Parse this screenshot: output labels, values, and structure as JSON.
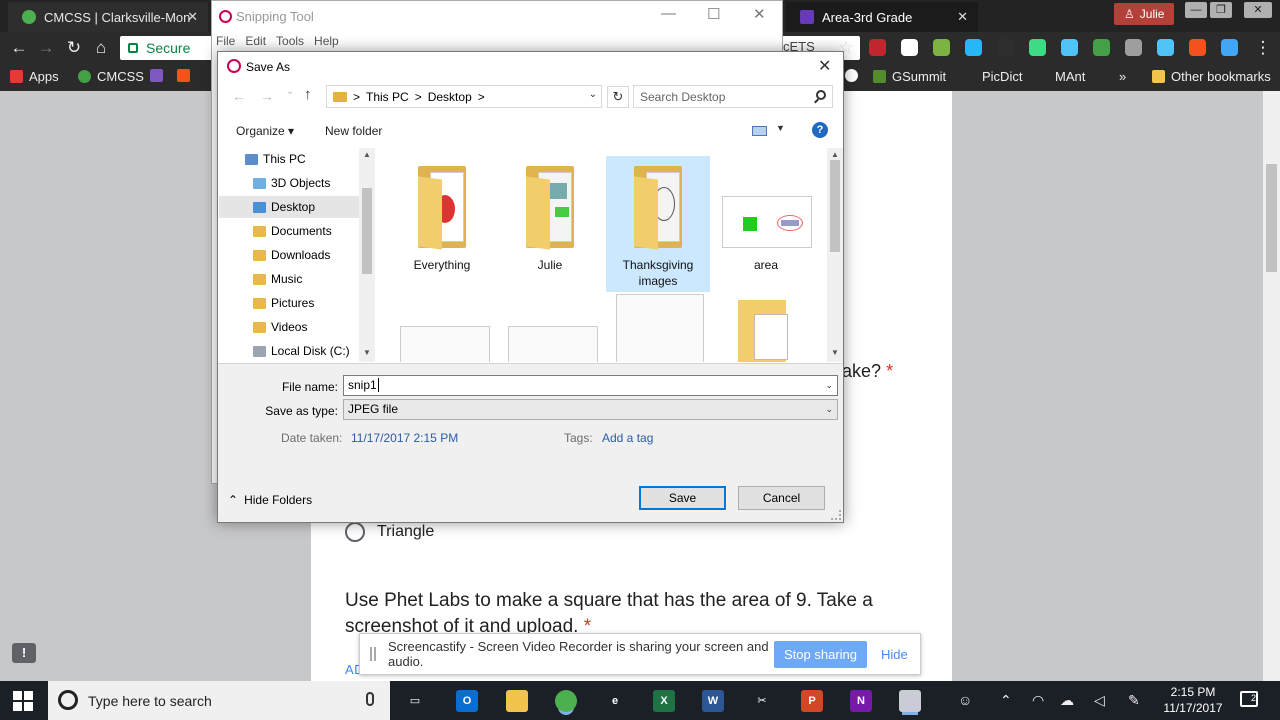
{
  "browser": {
    "tabs": [
      {
        "title": "CMCSS | Clarksville-Mon",
        "close": "✕"
      },
      {
        "title": "Area-3rd Grade",
        "close": "✕"
      }
    ],
    "user": "Julie",
    "window_controls": {
      "minimize": "—",
      "maximize": "❐",
      "close": "✕"
    },
    "secure_label": "Secure",
    "omnibox_tail": "cETS",
    "nav_icons": {
      "back": "←",
      "forward": "→",
      "reload": "↻",
      "home": "⌂"
    },
    "extensions": [
      {
        "color": "#c0262d"
      },
      {
        "color": "#ffffff"
      },
      {
        "color": "#7cb342"
      },
      {
        "color": "#29b6f6"
      },
      {
        "color": "#2e2e2e"
      },
      {
        "color": "#3ddc84"
      },
      {
        "color": "#4fc3f7"
      },
      {
        "color": "#43a047"
      },
      {
        "color": "#9e9e9e"
      },
      {
        "color": "#4fc3f7"
      },
      {
        "color": "#f4511e"
      },
      {
        "color": "#42a5f5"
      }
    ],
    "menu_icon": "⋮",
    "bookmarks": [
      {
        "label": "Apps",
        "color": "#e53935"
      },
      {
        "label": "CMCSS",
        "color": "#43a047"
      },
      {
        "label": "",
        "color": "#7e57c2"
      },
      {
        "label": "",
        "color": "#f4511e"
      }
    ],
    "bookmarks_right": [
      {
        "label": "GSummit",
        "color": "#558b2f"
      },
      {
        "label": "PicDict",
        "color": ""
      },
      {
        "label": "MAnt",
        "color": ""
      }
    ],
    "more_bookmarks": "»",
    "other_bookmarks": "Other bookmarks"
  },
  "form": {
    "q1_tail": "ake?",
    "required_mark": "*",
    "option_triangle": "Triangle",
    "q2_text": "Use Phet Labs to make a square that has the area of 9. Take a screenshot of it and upload.",
    "add_file": "ADD FILE",
    "feedback_icon": "!"
  },
  "screencastify": {
    "message": "Screencastify - Screen Video Recorder is sharing your screen and audio.",
    "stop": "Stop sharing",
    "hide": "Hide"
  },
  "snipping_tool": {
    "title": "Snipping Tool",
    "menu": [
      "File",
      "Edit",
      "Tools",
      "Help"
    ],
    "controls": {
      "minimize": "—",
      "maximize": "☐",
      "close": "✕"
    }
  },
  "save_dialog": {
    "title": "Save As",
    "close": "✕",
    "back": "←",
    "forward": "→",
    "recent": "⌄",
    "up": "↑",
    "path": [
      "This PC",
      "Desktop"
    ],
    "path_sep": ">",
    "refresh": "↻",
    "search_placeholder": "Search Desktop",
    "organize": "Organize ▾",
    "new_folder": "New folder",
    "help": "?",
    "nav_items": [
      {
        "label": "This PC",
        "selected": false
      },
      {
        "label": "3D Objects",
        "selected": false
      },
      {
        "label": "Desktop",
        "selected": true
      },
      {
        "label": "Documents",
        "selected": false
      },
      {
        "label": "Downloads",
        "selected": false
      },
      {
        "label": "Music",
        "selected": false
      },
      {
        "label": "Pictures",
        "selected": false
      },
      {
        "label": "Videos",
        "selected": false
      },
      {
        "label": "Local Disk (C:)",
        "selected": false
      }
    ],
    "items": [
      {
        "label": "Everything",
        "type": "folder"
      },
      {
        "label": "Julie",
        "type": "folder"
      },
      {
        "label": "Thanksgiving images",
        "type": "folder",
        "selected": true
      },
      {
        "label": "area",
        "type": "image"
      }
    ],
    "file_name_label": "File name:",
    "file_name_value": "snip1",
    "type_label": "Save as type:",
    "type_value": "JPEG file",
    "date_label": "Date taken:",
    "date_value": "11/17/2017 2:15 PM",
    "tags_label": "Tags:",
    "tags_value": "Add a tag",
    "hide_folders": "Hide Folders",
    "save": "Save",
    "cancel": "Cancel"
  },
  "taskbar": {
    "search_placeholder": "Type here to search",
    "apps": [
      {
        "name": "task-view",
        "glyph": "▭",
        "color": "#1b2027"
      },
      {
        "name": "outlook",
        "glyph": "O",
        "color": "#0a6ed1"
      },
      {
        "name": "file-explorer",
        "glyph": "",
        "color": "#f2c44e"
      },
      {
        "name": "chrome",
        "glyph": "",
        "color": "#4caf50"
      },
      {
        "name": "edge",
        "glyph": "e",
        "color": "#1b2027"
      },
      {
        "name": "excel",
        "glyph": "X",
        "color": "#1f7244"
      },
      {
        "name": "word",
        "glyph": "W",
        "color": "#2b5797"
      },
      {
        "name": "snipping-scissors",
        "glyph": "✂",
        "color": "#1b2027"
      },
      {
        "name": "powerpoint",
        "glyph": "P",
        "color": "#d24726"
      },
      {
        "name": "onenote",
        "glyph": "N",
        "color": "#7719aa"
      },
      {
        "name": "snipping-tool",
        "glyph": "",
        "color": "#c9ccd4"
      }
    ],
    "time": "2:15 PM",
    "date": "11/17/2017",
    "notifications": "2"
  }
}
